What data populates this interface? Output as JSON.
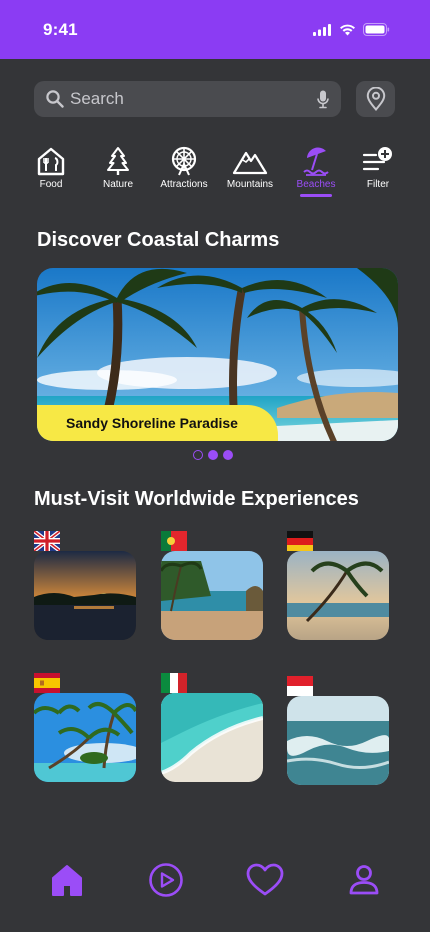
{
  "status_bar": {
    "time": "9:41"
  },
  "search": {
    "placeholder": "Search"
  },
  "categories": [
    {
      "label": "Food",
      "icon": "food-icon"
    },
    {
      "label": "Nature",
      "icon": "tree-icon"
    },
    {
      "label": "Attractions",
      "icon": "ferris-wheel-icon"
    },
    {
      "label": "Mountains",
      "icon": "mountain-icon"
    },
    {
      "label": "Beaches",
      "icon": "beach-umbrella-icon",
      "active": true
    },
    {
      "label": "Filter",
      "icon": "filter-add-icon"
    }
  ],
  "hero": {
    "section_title": "Discover Coastal Charms",
    "caption": "Sandy Shoreline Paradise",
    "carousel_dots": 3,
    "active_dot": 1
  },
  "experiences": {
    "section_title": "Must-Visit Worldwide Experiences",
    "cards": [
      {
        "flag": "united-kingdom-flag-icon",
        "scene": "sunset-beach"
      },
      {
        "flag": "portugal-flag-icon",
        "scene": "palm-cove"
      },
      {
        "flag": "germany-flag-icon",
        "scene": "leaning-palm"
      },
      {
        "flag": "spain-flag-icon",
        "scene": "tropical-palms"
      },
      {
        "flag": "italy-flag-icon",
        "scene": "turquoise-shore"
      },
      {
        "flag": "indonesia-flag-icon",
        "scene": "ocean-waves"
      }
    ]
  },
  "tabbar": [
    {
      "icon": "home-icon"
    },
    {
      "icon": "play-icon"
    },
    {
      "icon": "heart-icon"
    },
    {
      "icon": "profile-icon"
    }
  ],
  "colors": {
    "accent": "#9b4df7",
    "status_bar": "#8b3cf3",
    "background": "#343538",
    "caption": "#f7e845"
  }
}
